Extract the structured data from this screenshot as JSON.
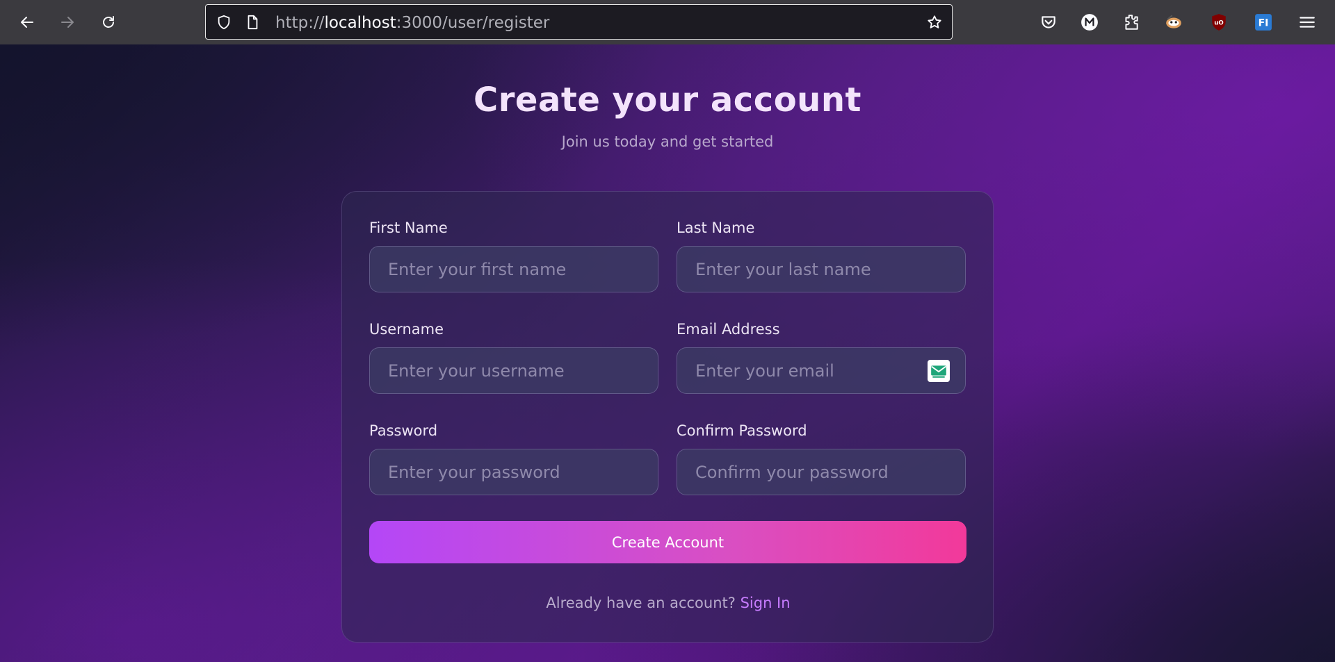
{
  "browser": {
    "url_prefix": "http://",
    "url_host": "localhost",
    "url_rest": ":3000/user/register"
  },
  "header": {
    "title": "Create your account",
    "subtitle": "Join us today and get started"
  },
  "form": {
    "first_name": {
      "label": "First Name",
      "placeholder": "Enter your first name",
      "value": ""
    },
    "last_name": {
      "label": "Last Name",
      "placeholder": "Enter your last name",
      "value": ""
    },
    "username": {
      "label": "Username",
      "placeholder": "Enter your username",
      "value": ""
    },
    "email": {
      "label": "Email Address",
      "placeholder": "Enter your email",
      "value": ""
    },
    "password": {
      "label": "Password",
      "placeholder": "Enter your password",
      "value": ""
    },
    "confirm_password": {
      "label": "Confirm Password",
      "placeholder": "Confirm your password",
      "value": ""
    },
    "submit_label": "Create Account"
  },
  "footer": {
    "prompt": "Already have an account?",
    "link_label": "Sign In"
  },
  "colors": {
    "accent_start": "#b447f7",
    "accent_end": "#f2399a",
    "link": "#c77cff"
  }
}
